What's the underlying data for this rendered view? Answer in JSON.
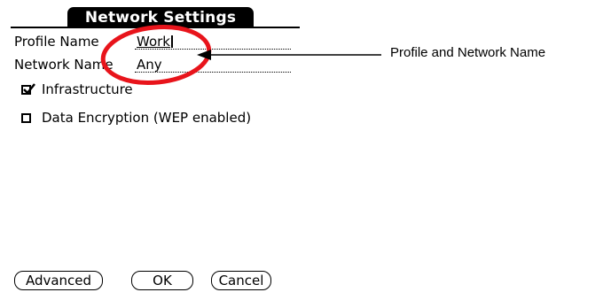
{
  "window": {
    "title": "Network Settings"
  },
  "profile": {
    "label": "Profile Name",
    "value": "Work"
  },
  "network": {
    "label": "Network Name",
    "value": "Any"
  },
  "options": [
    {
      "label": "Infrastructure",
      "checked": true
    },
    {
      "label": "Data Encryption (WEP enabled)",
      "checked": false
    }
  ],
  "buttons": {
    "advanced": "Advanced",
    "ok": "OK",
    "cancel": "Cancel"
  },
  "annotation": {
    "text": "Profile and Network Name",
    "highlight_color": "#e8141b"
  }
}
